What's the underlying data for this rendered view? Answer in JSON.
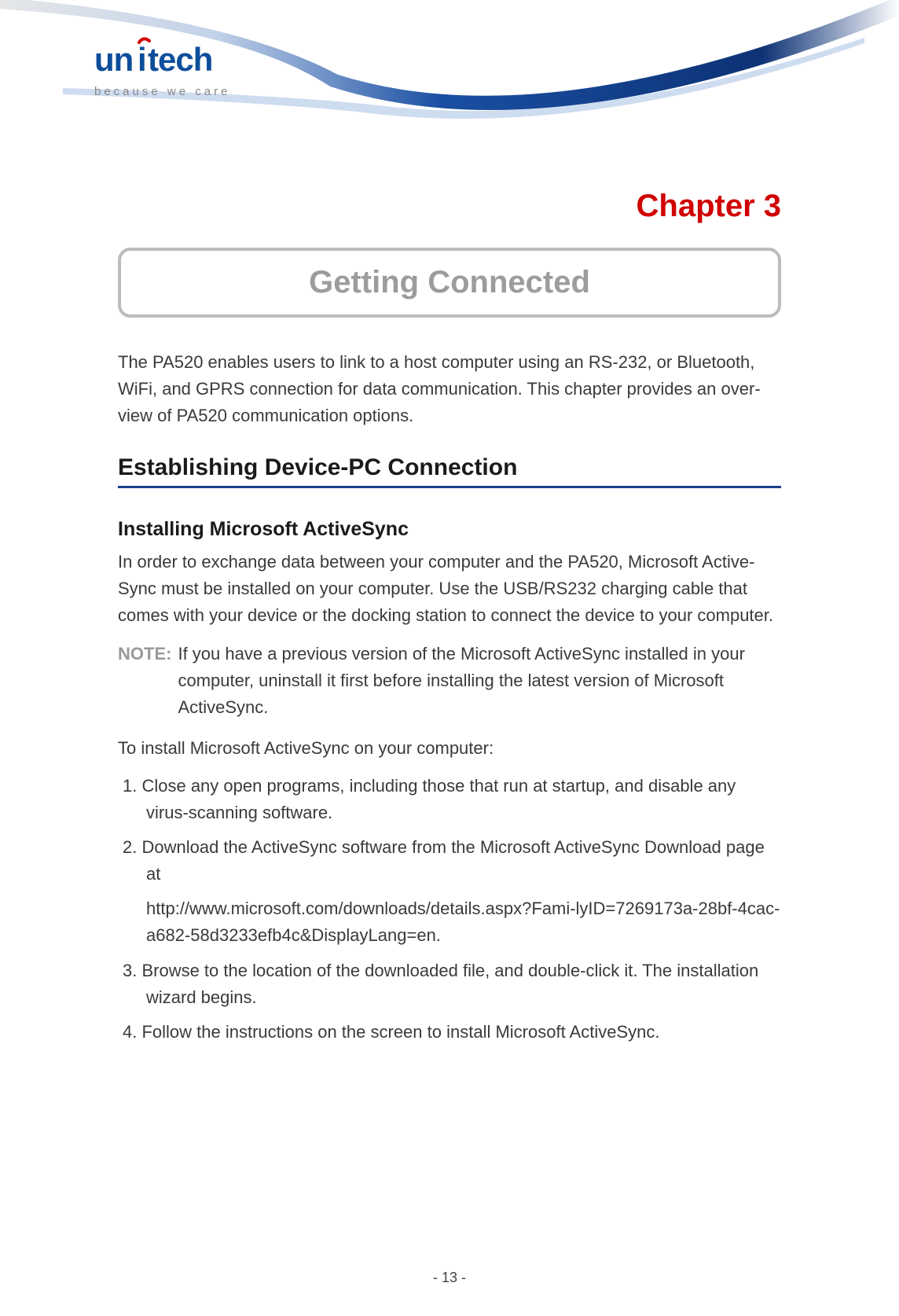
{
  "header": {
    "logo_main": "unitech",
    "logo_tag": "because we care"
  },
  "chapter_label": "Chapter 3",
  "title_box": "Getting Connected",
  "intro": "The PA520 enables users to link to a host computer using an RS-232, or Bluetooth, WiFi, and GPRS connection for data communication. This chapter provides an over-view of PA520 communication options.",
  "section_heading": "Establishing Device-PC Connection",
  "sub_heading": "Installing Microsoft ActiveSync",
  "body1": "In order to exchange data between your computer and the PA520, Microsoft Active-Sync must be installed on your computer. Use the USB/RS232 charging cable that comes with your device or the docking station to connect the device to your computer.",
  "note_label": "NOTE:",
  "note_text": "If you have a previous version of the Microsoft ActiveSync installed in your computer, uninstall it first before installing the latest version of Microsoft ActiveSync.",
  "body2": "To install Microsoft ActiveSync on your computer:",
  "steps": {
    "s1": "1. Close any open programs, including those that run at startup, and disable any virus-scanning software.",
    "s2": "2. Download the ActiveSync software from the Microsoft ActiveSync Download page at",
    "s2_url": "http://www.microsoft.com/downloads/details.aspx?Fami-lyID=7269173a-28bf-4cac-a682-58d3233efb4c&DisplayLang=en.",
    "s3": "3.  Browse to the location of the downloaded file, and double-click it. The installation wizard begins.",
    "s4": "4.  Follow the instructions on the screen to install Microsoft ActiveSync."
  },
  "page_number": "- 13 -"
}
